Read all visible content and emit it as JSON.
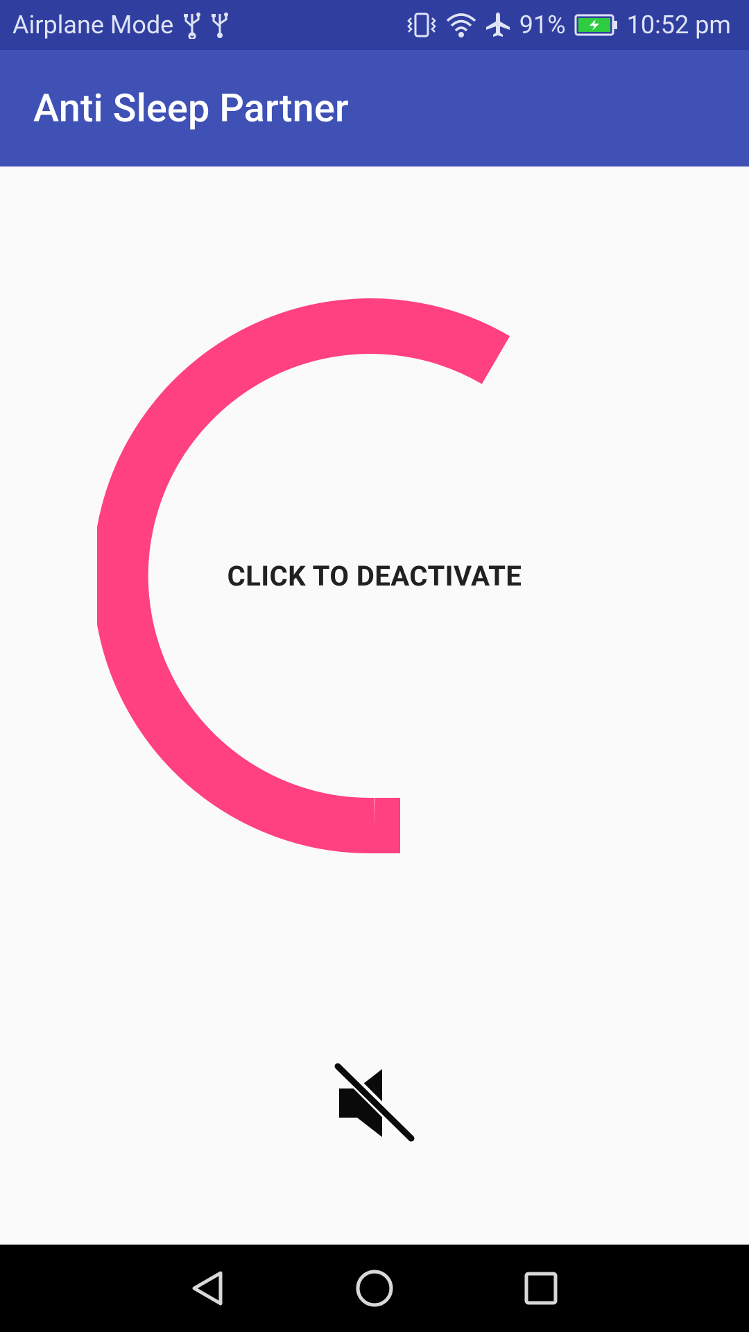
{
  "status_bar": {
    "airplane_mode_label": "Airplane Mode",
    "battery_percent": "91%",
    "time": "10:52 pm",
    "icons": [
      "usb-icon",
      "usb-icon",
      "vibrate-icon",
      "wifi-icon",
      "airplane-icon",
      "battery-charging-icon"
    ]
  },
  "app_bar": {
    "title": "Anti Sleep Partner"
  },
  "main": {
    "toggle_label": "CLICK TO DEACTIVATE",
    "arc_color": "#ff4081",
    "mute_icon": "volume-off-icon"
  },
  "nav_bar": {
    "buttons": [
      "back-icon",
      "home-icon",
      "recents-icon"
    ]
  },
  "colors": {
    "status_bar": "#303f9f",
    "app_bar": "#3f51b5",
    "accent": "#ff4081",
    "background": "#fafafa"
  }
}
